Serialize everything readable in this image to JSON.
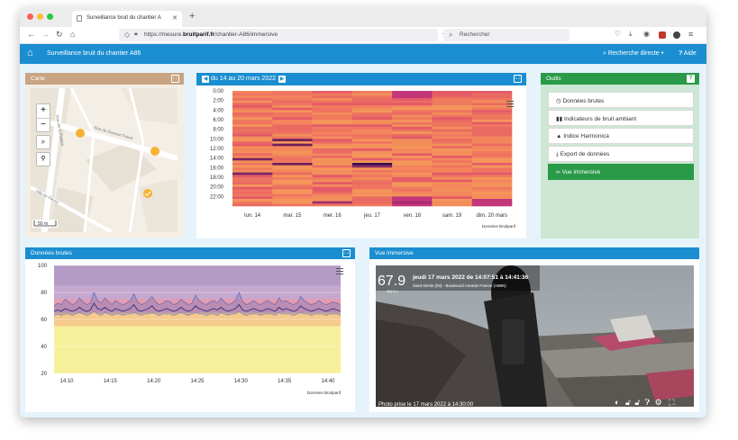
{
  "browser": {
    "tab_title": "Surveillance bruit du chantier A",
    "url_host": "https://mesure.",
    "url_domain": "bruitparif.fr",
    "url_path": "/chantier-A86/immersive",
    "search_placeholder": "Rechercher"
  },
  "app": {
    "title": "Surveillance bruit du chantier A86",
    "search_link": "Recherche directe",
    "help_link": "Aide"
  },
  "map": {
    "title": "Carte",
    "street_1": "Rue du Docteur Poiret",
    "street_2": "Rue de la Poterie",
    "street_3": "Villa de Fleury",
    "scale": "50 m",
    "zoom_in": "+",
    "zoom_out": "−"
  },
  "heatmap": {
    "title": "du 14 au 20 mars 2022",
    "y_labels": [
      "0:00",
      "2:00",
      "4:00",
      "6:00",
      "8:00",
      "10:00",
      "12:00",
      "14:00",
      "16:00",
      "18:00",
      "20:00",
      "22:00"
    ],
    "x_labels": [
      "lun. 14",
      "mar. 15",
      "mer. 16",
      "jeu. 17",
      "ven. 18",
      "sam. 19",
      "dim. 20 mars"
    ],
    "credit": "Données Bruitparif"
  },
  "tools": {
    "title": "Outils",
    "items": [
      {
        "label": "Données brutes",
        "icon": "clock-icon"
      },
      {
        "label": "Indicateurs de bruit ambiant",
        "icon": "bar-chart-icon"
      },
      {
        "label": "Indice Harmonica",
        "icon": "triangle-icon"
      },
      {
        "label": "Export de données",
        "icon": "download-icon"
      },
      {
        "label": "Vue immersive",
        "icon": "binoculars-icon"
      }
    ]
  },
  "raw": {
    "title": "Données brutes",
    "credit": "Données Bruitparif"
  },
  "chart_data": {
    "type": "line",
    "title": "",
    "ylim": [
      20,
      100
    ],
    "yticks": [
      20,
      40,
      60,
      80,
      100
    ],
    "x_labels": [
      "14:10",
      "14:15",
      "14:20",
      "14:25",
      "14:30",
      "14:35",
      "14:40"
    ],
    "bands": [
      {
        "from": 20,
        "to": 55,
        "color": "#f7f09b"
      },
      {
        "from": 55,
        "to": 65,
        "color": "#f5ca8b"
      },
      {
        "from": 65,
        "to": 75,
        "color": "#e59bb0"
      },
      {
        "from": 75,
        "to": 85,
        "color": "#c6a8cf"
      },
      {
        "from": 85,
        "to": 100,
        "color": "#b49bc6"
      }
    ],
    "series": [
      {
        "values": [
          66,
          67,
          66,
          68,
          67,
          66,
          67,
          69,
          67,
          66,
          67,
          72,
          68,
          67,
          69,
          67,
          66,
          68,
          67,
          66,
          67,
          68,
          71,
          67,
          66,
          67,
          68,
          70,
          67,
          66,
          67,
          68,
          67,
          66,
          67,
          69,
          67,
          66,
          67,
          70,
          68,
          67,
          66,
          67,
          68,
          67,
          69,
          67,
          66,
          67,
          68,
          71,
          67,
          66,
          67,
          68,
          67,
          66,
          67,
          68,
          67,
          66,
          69,
          67,
          68,
          67,
          66,
          67,
          70,
          68,
          67,
          66,
          67,
          68,
          67,
          66,
          67,
          68,
          67,
          66
        ]
      },
      {
        "values": [
          70,
          72,
          71,
          75,
          73,
          71,
          72,
          76,
          73,
          71,
          72,
          80,
          74,
          72,
          76,
          73,
          71,
          74,
          72,
          71,
          72,
          74,
          79,
          73,
          71,
          72,
          74,
          77,
          73,
          71,
          72,
          74,
          73,
          71,
          72,
          75,
          73,
          71,
          72,
          78,
          74,
          72,
          71,
          73,
          74,
          72,
          76,
          73,
          71,
          72,
          74,
          80,
          73,
          71,
          72,
          74,
          72,
          71,
          73,
          74,
          72,
          71,
          76,
          73,
          74,
          72,
          71,
          72,
          77,
          74,
          72,
          71,
          72,
          74,
          72,
          71,
          72,
          73,
          72,
          71
        ]
      },
      {
        "values": [
          63,
          64,
          63,
          64,
          64,
          63,
          64,
          65,
          64,
          63,
          64,
          66,
          64,
          63,
          65,
          64,
          63,
          64,
          64,
          63,
          64,
          64,
          65,
          64,
          63,
          64,
          64,
          65,
          64,
          63,
          64,
          64,
          64,
          63,
          64,
          65,
          64,
          63,
          64,
          65,
          64,
          64,
          63,
          64,
          64,
          63,
          65,
          64,
          63,
          64,
          64,
          66,
          64,
          63,
          64,
          64,
          64,
          63,
          64,
          64,
          64,
          63,
          65,
          64,
          64,
          64,
          63,
          64,
          65,
          64,
          64,
          63,
          64,
          64,
          64,
          63,
          64,
          64,
          64,
          63
        ]
      }
    ]
  },
  "immersive": {
    "title": "Vue immersive",
    "level": "67.9",
    "unit": "dB( A )",
    "datetime": "jeudi 17 mars 2022 de 14:07:51 à 14:41:36",
    "location": "Saint-Denis (93) - Boulevard Anatole France (A86N)",
    "caption": "Photo prise le 17 mars 2022 à 14:30:00"
  },
  "colors": {
    "accent": "#1a8ed0",
    "map_header": "#c8a482",
    "tools_header": "#2a9a48",
    "tools_bg": "#cde7d4"
  }
}
